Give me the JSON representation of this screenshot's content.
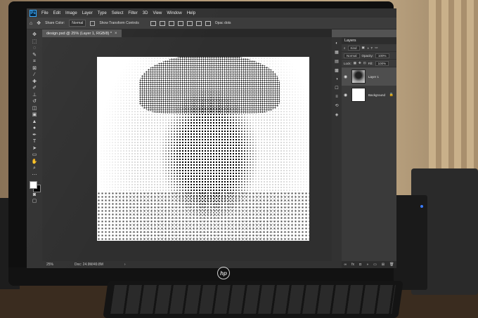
{
  "menubar": {
    "logo": "Ps",
    "items": [
      "File",
      "Edit",
      "Image",
      "Layer",
      "Type",
      "Select",
      "Filter",
      "3D",
      "View",
      "Window",
      "Help"
    ]
  },
  "options": {
    "mode_label": "Share Color:",
    "mode_value": "Normal",
    "transform_label": "Show Transform Controls",
    "extra_label": "Opac dots"
  },
  "document": {
    "tab_title": "design.psd @ 25% (Layer 1, RGB/8) *",
    "close": "×"
  },
  "status": {
    "zoom": "25%",
    "doc_size": "Doc: 24.9M/49.8M",
    "arrow": "›"
  },
  "layers_panel": {
    "title": "Layers",
    "filter_kind": "Kind",
    "blend_mode": "Normal",
    "opacity_label": "Opacity:",
    "opacity_value": "100%",
    "lock_label": "Lock:",
    "fill_label": "Fill:",
    "fill_value": "100%",
    "layers": [
      {
        "name": "Layer 1",
        "active": true
      },
      {
        "name": "Background",
        "active": false
      }
    ]
  },
  "monitor": {
    "brand": "hp"
  }
}
